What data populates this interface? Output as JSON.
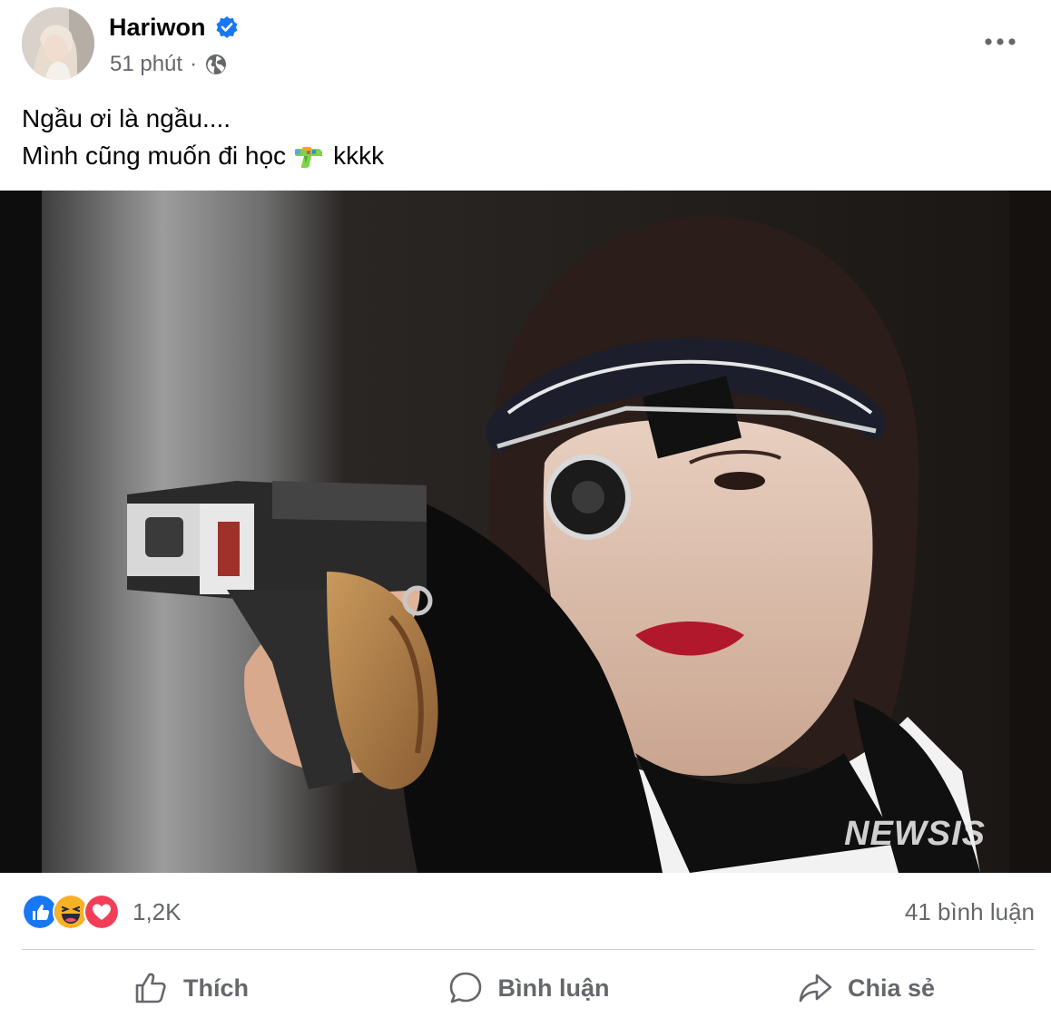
{
  "post": {
    "author": "Hariwon",
    "time": "51 phút",
    "separator": "·",
    "lines": [
      "Ngầu ơi là ngầu....",
      "Mình cũng muốn đi học",
      "kkkk"
    ],
    "emoji": "water-pistol-emoji"
  },
  "photo": {
    "watermark": "NEWSIS"
  },
  "stats": {
    "reaction_count": "1,2K",
    "comment_count": "41 bình luận",
    "reactions": [
      "like",
      "haha",
      "love"
    ]
  },
  "actions": {
    "like": "Thích",
    "comment": "Bình luận",
    "share": "Chia sẻ"
  },
  "colors": {
    "verified": "#1877f2",
    "like": "#1877f2",
    "haha": "#f7b125",
    "love": "#f33e58",
    "secondary_text": "#65676b"
  }
}
